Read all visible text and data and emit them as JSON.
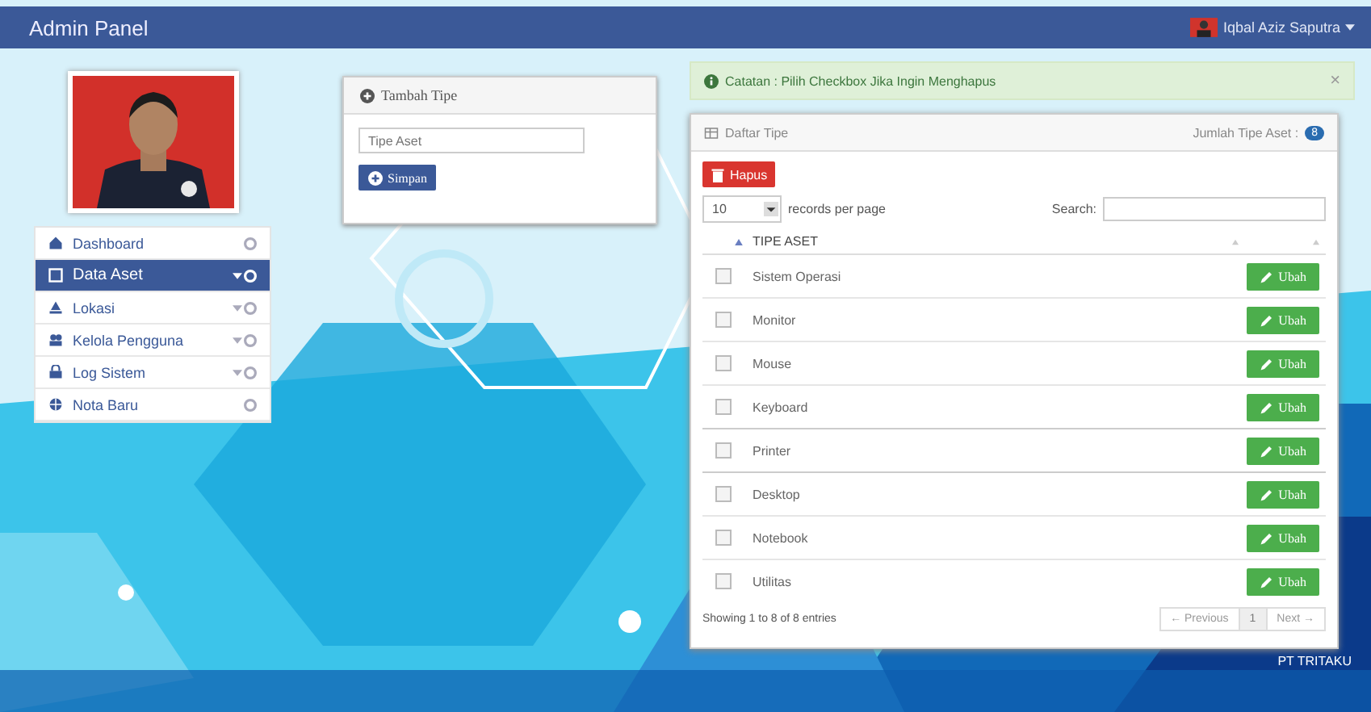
{
  "header": {
    "title": "Admin Panel",
    "user": "Iqbal Aziz Saputra"
  },
  "sidebar": {
    "items": [
      {
        "label": "Dashboard",
        "expandable": false,
        "selected": false
      },
      {
        "label": "Data Aset",
        "expandable": true,
        "selected": true
      },
      {
        "label": "Lokasi",
        "expandable": true,
        "selected": false
      },
      {
        "label": "Kelola Pengguna",
        "expandable": true,
        "selected": false
      },
      {
        "label": "Log Sistem",
        "expandable": true,
        "selected": false
      },
      {
        "label": "Nota Baru",
        "expandable": false,
        "selected": false
      }
    ]
  },
  "add_form": {
    "title": "Tambah Tipe",
    "placeholder": "Tipe Aset",
    "button": "Simpan"
  },
  "alert": {
    "text": "Catatan : Pilih Checkbox Jika Ingin Menghapus",
    "close": "×"
  },
  "list": {
    "title": "Daftar Tipe",
    "count_label": "Jumlah Tipe Aset :",
    "count": "8",
    "delete_button": "Hapus",
    "page_size": "10",
    "page_size_label": "records per page",
    "search_label": "Search:",
    "columns": [
      "TIPE ASET"
    ],
    "rows": [
      {
        "name": "Sistem Operasi",
        "checked": false,
        "action": "Ubah"
      },
      {
        "name": "Monitor",
        "checked": false,
        "action": "Ubah"
      },
      {
        "name": "Mouse",
        "checked": false,
        "action": "Ubah"
      },
      {
        "name": "Keyboard",
        "checked": false,
        "action": "Ubah"
      },
      {
        "name": "Printer",
        "checked": false,
        "action": "Ubah"
      },
      {
        "name": "Desktop",
        "checked": false,
        "action": "Ubah"
      },
      {
        "name": "Notebook",
        "checked": false,
        "action": "Ubah"
      },
      {
        "name": "Utilitas",
        "checked": false,
        "action": "Ubah"
      }
    ],
    "info": "Showing 1 to 8 of 8 entries",
    "pagination": [
      {
        "label": "← Previous",
        "selected": false
      },
      {
        "label": "1",
        "selected": true
      },
      {
        "label": "Next →",
        "selected": false
      }
    ]
  },
  "footer": {
    "text": "PT TRITAKU"
  }
}
